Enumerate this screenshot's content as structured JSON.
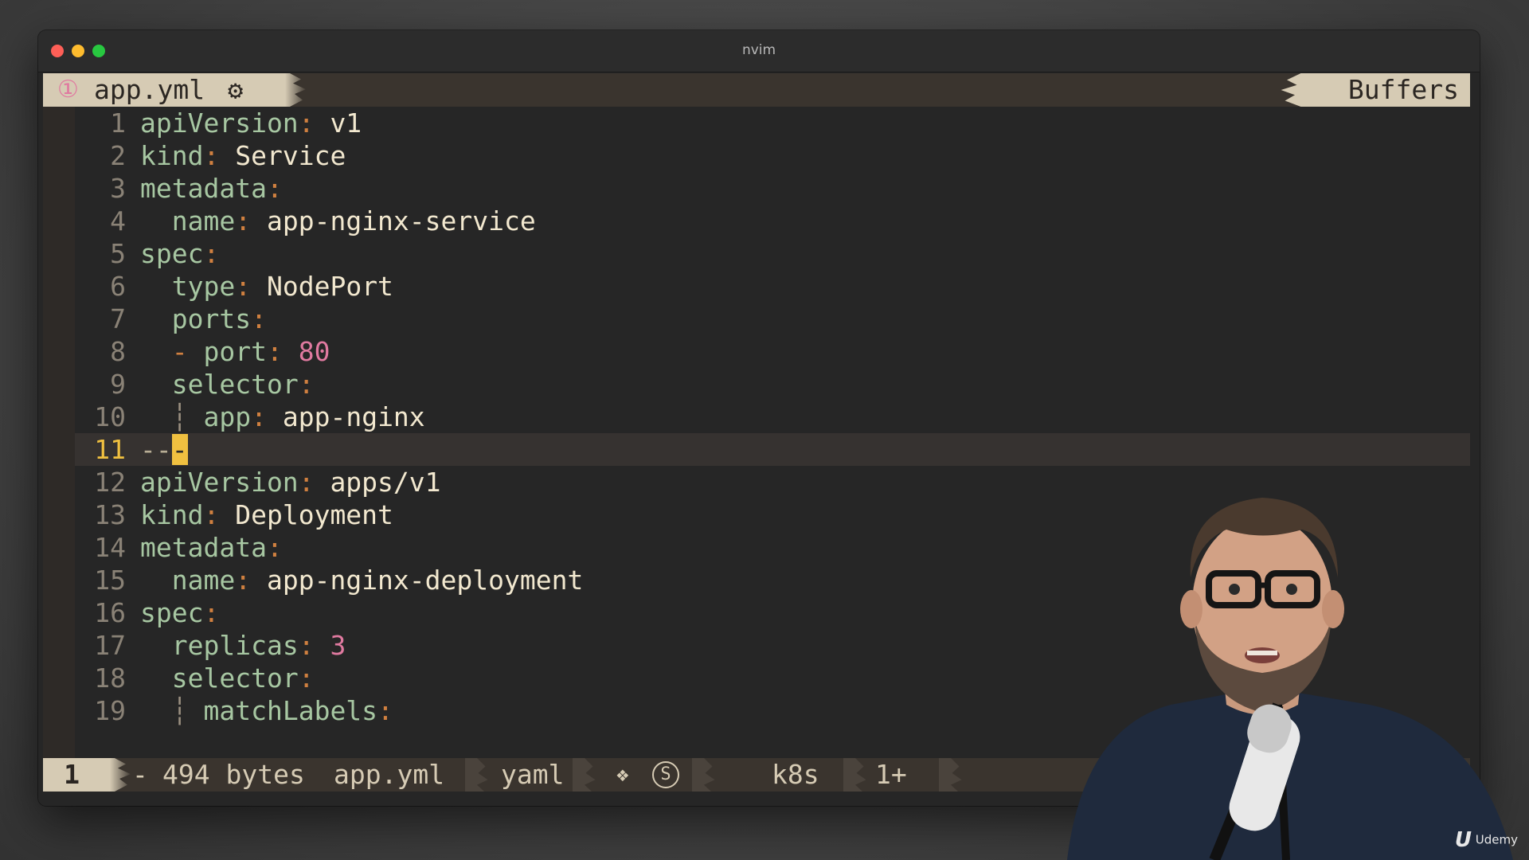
{
  "window": {
    "title": "nvim"
  },
  "tabline": {
    "tab_number": "①",
    "tab_name": "app.yml",
    "tab_icon": "gear-icon",
    "buffers_label": "Buffers"
  },
  "editor": {
    "current_line": 11,
    "lines": [
      {
        "n": "1"
      },
      {
        "n": "2"
      },
      {
        "n": "3"
      },
      {
        "n": "4"
      },
      {
        "n": "5"
      },
      {
        "n": "6"
      },
      {
        "n": "7"
      },
      {
        "n": "8"
      },
      {
        "n": "9"
      },
      {
        "n": "10"
      },
      {
        "n": "11"
      },
      {
        "n": "12"
      },
      {
        "n": "13"
      },
      {
        "n": "14"
      },
      {
        "n": "15"
      },
      {
        "n": "16"
      },
      {
        "n": "17"
      },
      {
        "n": "18"
      },
      {
        "n": "19"
      }
    ],
    "tokens": {
      "l1_key": "apiVersion",
      "l1_val": "v1",
      "l2_key": "kind",
      "l2_val": "Service",
      "l3_key": "metadata",
      "l4_key": "name",
      "l4_val": "app-nginx-service",
      "l5_key": "spec",
      "l6_key": "type",
      "l6_val": "NodePort",
      "l7_key": "ports",
      "l8_dash": "-",
      "l8_key": "port",
      "l8_val": "80",
      "l9_key": "selector",
      "l10_guide": "┆",
      "l10_key": "app",
      "l10_val": "app-nginx",
      "l11_sep": "--",
      "l11_cursor": "-",
      "l12_key": "apiVersion",
      "l12_val": "apps/v1",
      "l13_key": "kind",
      "l13_val": "Deployment",
      "l14_key": "metadata",
      "l15_key": "name",
      "l15_val": "app-nginx-deployment",
      "l16_key": "spec",
      "l17_key": "replicas",
      "l17_val": "3",
      "l18_key": "selector",
      "l19_guide": "┆",
      "l19_key": "matchLabels",
      "colon": ":"
    }
  },
  "statusline": {
    "mode": "1",
    "modified": "-",
    "size": "494 bytes",
    "filename": "app.yml",
    "filetype": "yaml",
    "diamond": "❖",
    "s_icon": "S",
    "branch_icon": "branch-icon",
    "branch": "k8s",
    "changes": "1+"
  },
  "watermark": {
    "logo_letter": "U",
    "text": "Udemy"
  },
  "colors": {
    "tab_bg": "#d6cbb4",
    "bar_bg": "#3a342e",
    "editor_bg": "#262626",
    "key": "#a7c7a2",
    "punct": "#d08040",
    "number": "#e07aa0",
    "cursor": "#f0c040"
  }
}
